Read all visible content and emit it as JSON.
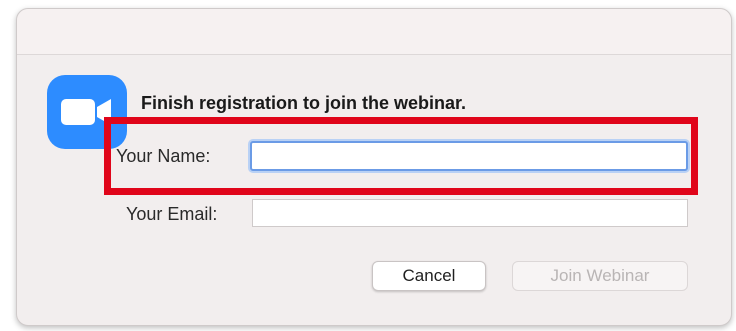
{
  "dialog": {
    "heading": "Finish registration to join the webinar.",
    "app_icon": "zoom-video-camera-icon",
    "accent_color": "#2d8cff",
    "highlight_color": "#e0051a"
  },
  "form": {
    "name_label": "Your Name:",
    "name_value": "",
    "email_label": "Your Email:",
    "email_value": ""
  },
  "buttons": {
    "cancel_label": "Cancel",
    "join_label": "Join Webinar"
  }
}
